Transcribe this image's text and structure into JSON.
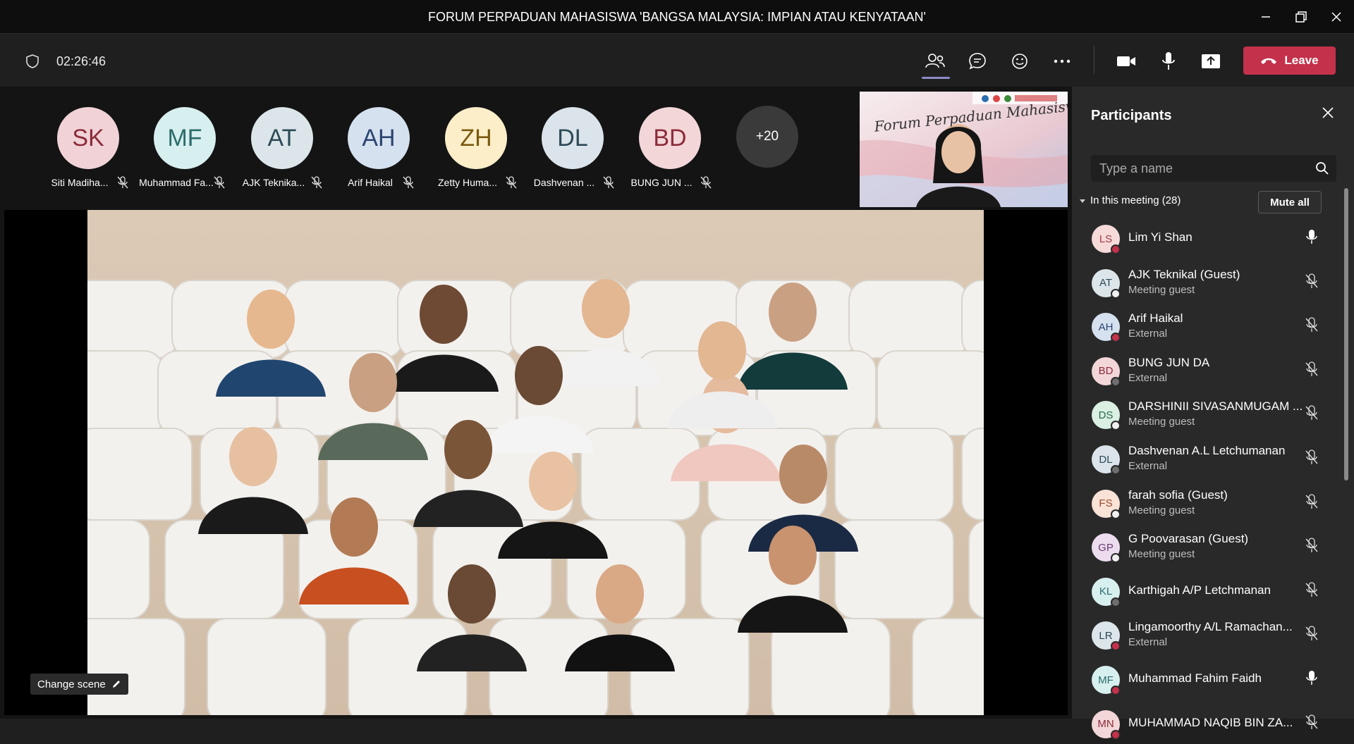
{
  "window": {
    "title": "FORUM PERPADUAN MAHASISWA 'BANGSA MALAYSIA: IMPIAN ATAU KENYATAAN'"
  },
  "toolbar": {
    "timer": "02:26:46",
    "leave_label": "Leave"
  },
  "gallery": {
    "avatars": [
      {
        "initials": "SK",
        "name": "Siti Madiha...",
        "bg": "#f1d3d7",
        "fg": "#8c2b3a"
      },
      {
        "initials": "MF",
        "name": "Muhammad Fa...",
        "bg": "#d8efef",
        "fg": "#2b6b6b"
      },
      {
        "initials": "AT",
        "name": "AJK Teknika...",
        "bg": "#dce6ea",
        "fg": "#2d4a57"
      },
      {
        "initials": "AH",
        "name": "Arif Haikal",
        "bg": "#d6e1f0",
        "fg": "#2b4470"
      },
      {
        "initials": "ZH",
        "name": "Zetty Huma...",
        "bg": "#fbeec9",
        "fg": "#7a5a10"
      },
      {
        "initials": "DL",
        "name": "Dashvenan ...",
        "bg": "#dbe4ea",
        "fg": "#2d4a57"
      },
      {
        "initials": "BD",
        "name": "BUNG JUN ...",
        "bg": "#f3d6d8",
        "fg": "#8c2b3a"
      }
    ],
    "overflow": "+20"
  },
  "selfview": {
    "banner_text": "Forum Perpaduan Mahasiswa"
  },
  "stage": {
    "change_scene_label": "Change scene"
  },
  "participants": {
    "title": "Participants",
    "search_placeholder": "Type a name",
    "section_label": "In this meeting (28)",
    "mute_all_label": "Mute all",
    "list": [
      {
        "initials": "LS",
        "name": "Lim Yi Shan",
        "role": "",
        "bg": "#f6dada",
        "fg": "#a33b4b",
        "status": "red",
        "mic": "on"
      },
      {
        "initials": "AT",
        "name": "AJK Teknikal (Guest)",
        "role": "Meeting guest",
        "bg": "#dce6ea",
        "fg": "#2d4a57",
        "status": "white",
        "mic": "off"
      },
      {
        "initials": "AH",
        "name": "Arif Haikal",
        "role": "External",
        "bg": "#d6e1f0",
        "fg": "#2b4470",
        "status": "red",
        "mic": "off"
      },
      {
        "initials": "BD",
        "name": "BUNG JUN DA",
        "role": "External",
        "bg": "#f3d6d8",
        "fg": "#8c2b3a",
        "status": "gray",
        "mic": "off"
      },
      {
        "initials": "DS",
        "name": "DARSHINII SIVASANMUGAM ...",
        "role": "Meeting guest",
        "bg": "#d9f0e3",
        "fg": "#2a6a4a",
        "status": "white",
        "mic": "off"
      },
      {
        "initials": "DL",
        "name": "Dashvenan A.L Letchumanan",
        "role": "External",
        "bg": "#dbe4ea",
        "fg": "#2d4a57",
        "status": "gray",
        "mic": "off"
      },
      {
        "initials": "FS",
        "name": "farah sofia (Guest)",
        "role": "Meeting guest",
        "bg": "#f9e2d6",
        "fg": "#9a4a2a",
        "status": "white",
        "mic": "off"
      },
      {
        "initials": "GP",
        "name": "G Poovarasan (Guest)",
        "role": "Meeting guest",
        "bg": "#ecdcee",
        "fg": "#6a3a70",
        "status": "white",
        "mic": "off"
      },
      {
        "initials": "KL",
        "name": "Karthigah A/P Letchmanan",
        "role": "",
        "bg": "#d8efef",
        "fg": "#2b6b6b",
        "status": "gray",
        "mic": "off"
      },
      {
        "initials": "LR",
        "name": "Lingamoorthy A/L Ramachan...",
        "role": "External",
        "bg": "#dce6ea",
        "fg": "#2d4a57",
        "status": "red",
        "mic": "off"
      },
      {
        "initials": "MF",
        "name": "Muhammad Fahim Faidh",
        "role": "",
        "bg": "#d8efef",
        "fg": "#2b6b6b",
        "status": "red",
        "mic": "on"
      },
      {
        "initials": "MN",
        "name": "MUHAMMAD NAQIB BIN ZA...",
        "role": "",
        "bg": "#f3d6d8",
        "fg": "#8c2b3a",
        "status": "red",
        "mic": "off"
      }
    ]
  }
}
